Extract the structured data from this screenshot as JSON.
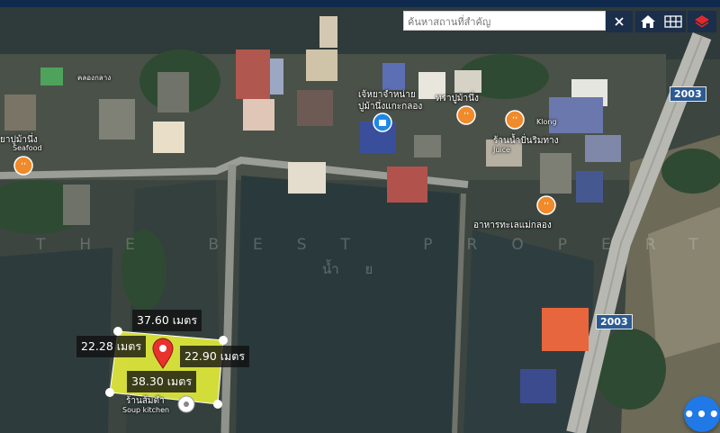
{
  "search": {
    "placeholder": "ค้นหาสถานที่สำคัญ"
  },
  "toolbar": {
    "close_icon": "close-icon",
    "home_icon": "home-icon",
    "grid_icon": "grid-icon",
    "layers_icon": "layers-icon"
  },
  "measurements": {
    "top": "37.60 เมตร",
    "left": "22.28 เมตร",
    "right": "22.90 เมตร",
    "bottom": "38.30 เมตร"
  },
  "pois": {
    "seafood_left": "ยาปูม้านึ่ง",
    "seafood_left_sub": "Seafood",
    "crab_shop": "เจ้หยาจำหน่าย",
    "crab_shop_2": "ปูม้านึ่งแกะกลอง",
    "tray_crab": "ทราปูม้านึ่ง",
    "klong": "Klong",
    "juice_shop": "ร้านน้ำปั่นริมทาง",
    "juice_sub": "Juice",
    "seafood_restaurant": "อาหารทะเลแม่กลอง",
    "soup_shop": "ร้านส้มตำ",
    "soup_sub": "Soup kitchen",
    "canal": "คลองกลาง"
  },
  "road_shields": [
    "2003",
    "2003"
  ],
  "watermark": {
    "text": "THE BEST PROPERTY",
    "sub": "น้ำ ย"
  },
  "fab": {
    "label": "•••"
  },
  "colors": {
    "pin": "#e8322e",
    "plot": "#e9f33a",
    "fab": "#2079e6",
    "shield": "#2c5b93"
  }
}
